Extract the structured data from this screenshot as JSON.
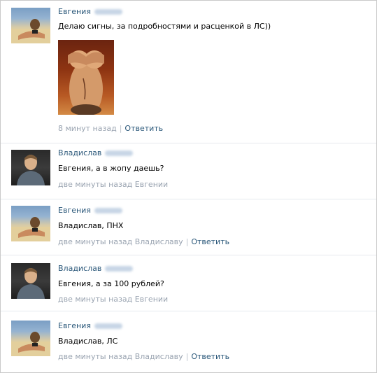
{
  "comments": [
    {
      "author": "Евгения",
      "text": "Делаю сигны, за подробностями и расценкой в ЛС))",
      "time": "8 минут назад",
      "reply_to": "",
      "reply_label": "Ответить",
      "avatar_icon": "user-avatar-girl"
    },
    {
      "author": "Владислав",
      "text": "Евгения, а в жопу даешь?",
      "time": "две минуты назад",
      "reply_to": "Евгении",
      "reply_label": "",
      "avatar_icon": "user-avatar-guy"
    },
    {
      "author": "Евгения",
      "text": "Владислав, ПНХ",
      "time": "две минуты назад",
      "reply_to": "Владиславу",
      "reply_label": "Ответить",
      "avatar_icon": "user-avatar-girl"
    },
    {
      "author": "Владислав",
      "text": "Евгения, а за 100 рублей?",
      "time": "две минуты назад",
      "reply_to": "Евгении",
      "reply_label": "",
      "avatar_icon": "user-avatar-guy"
    },
    {
      "author": "Евгения",
      "text": "Владислав, ЛС",
      "time": "две минуты назад",
      "reply_to": "Владиславу",
      "reply_label": "Ответить",
      "avatar_icon": "user-avatar-girl"
    }
  ],
  "colors": {
    "link": "#2b587a",
    "meta": "#9aa4b1",
    "divider": "#e6e9ee"
  }
}
